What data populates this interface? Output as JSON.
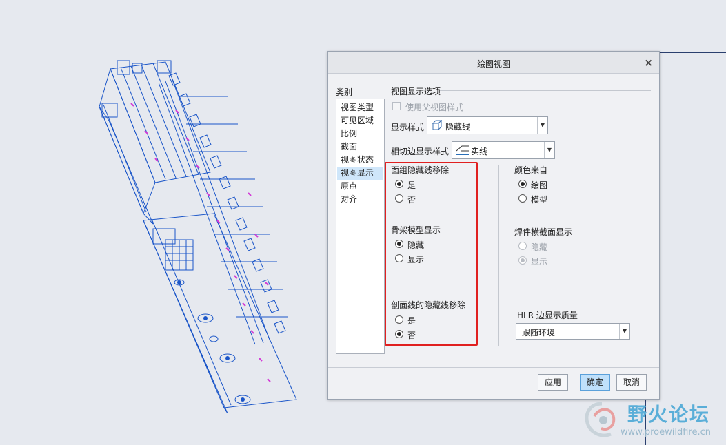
{
  "dialog": {
    "title": "绘图视图",
    "close_icon": "close-icon",
    "category_label": "类别",
    "categories": [
      "视图类型",
      "可见区域",
      "比例",
      "截面",
      "视图状态",
      "视图显示",
      "原点",
      "对齐"
    ],
    "selected_category": "视图显示",
    "options_header": "视图显示选项",
    "use_parent_style": "使用父视图样式",
    "display_style_label": "显示样式",
    "display_style_value": "隐藏线",
    "tangent_edge_label": "相切边显示样式",
    "tangent_edge_value": "实线",
    "face_hidden_removal": {
      "title": "面组隐藏线移除",
      "yes": "是",
      "no": "否",
      "selected": "是"
    },
    "skeleton_display": {
      "title": "骨架模型显示",
      "hide": "隐藏",
      "show": "显示",
      "selected": "隐藏"
    },
    "section_hidden_removal": {
      "title": "剖面线的隐藏线移除",
      "yes": "是",
      "no": "否",
      "selected": "否"
    },
    "color_source": {
      "title": "颜色来自",
      "drawing": "绘图",
      "model": "模型",
      "selected": "绘图"
    },
    "weld_section": {
      "title": "焊件横截面显示",
      "hide": "隐藏",
      "show": "显示",
      "selected": "显示",
      "disabled": true
    },
    "hlr_quality": {
      "label": "HLR 边显示质量",
      "value": "跟随环境"
    },
    "buttons": {
      "apply": "应用",
      "ok": "确定",
      "cancel": "取消"
    }
  },
  "watermark": {
    "name": "野火论坛",
    "url": "www.proewildfire.cn"
  },
  "colors": {
    "highlight_box": "#e02020",
    "selected_row": "#cfe6fa",
    "model_wire": "#1a55c8",
    "model_accent": "#d23ad6"
  }
}
